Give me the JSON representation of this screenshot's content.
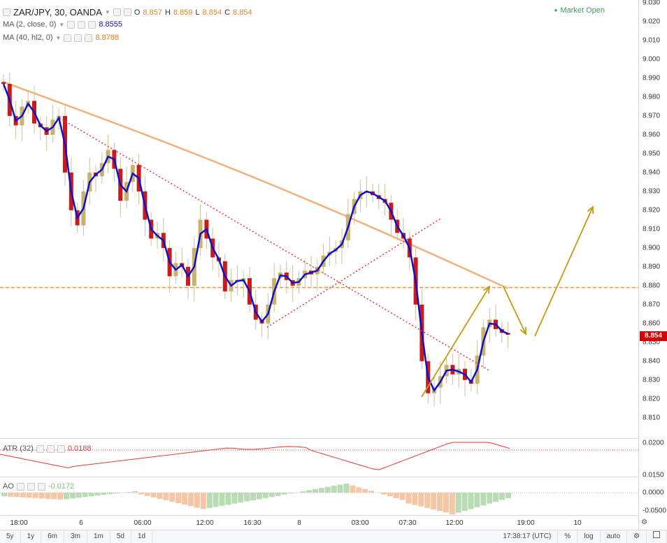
{
  "header": {
    "symbol": "ZAR/JPY, 30, OANDA",
    "open_label": "O",
    "open": "8.857",
    "high_label": "H",
    "high": "8.859",
    "low_label": "L",
    "low": "8.854",
    "close_label": "C",
    "close": "8.854",
    "market_status": "Market Open"
  },
  "indicators": [
    {
      "label": "MA (2, close, 0)",
      "value": "8.8555",
      "color": "#1010c8"
    },
    {
      "label": "MA (40, hl2, 0)",
      "value": "8.8788",
      "color": "#e07b1a"
    }
  ],
  "price_axis": {
    "ticks": [
      "9.030",
      "9.020",
      "9.010",
      "9.000",
      "8.990",
      "8.980",
      "8.970",
      "8.960",
      "8.950",
      "8.940",
      "8.930",
      "8.920",
      "8.910",
      "8.900",
      "8.890",
      "8.880",
      "8.870",
      "8.860",
      "8.850",
      "8.840",
      "8.830",
      "8.820",
      "8.810"
    ],
    "current_price": "8.854",
    "current_price_color": "#d50000"
  },
  "atr": {
    "label": "ATR (32)",
    "value": "0.0188",
    "ticks": [
      "0.0200",
      "0.0150"
    ],
    "color": "#e53935"
  },
  "ao": {
    "label": "AO",
    "value": "-0.0172",
    "ticks": [
      "0.0000",
      "-0.0500"
    ],
    "color": "#7cbf7c"
  },
  "time_axis": [
    "18:00",
    "6",
    "06:00",
    "12:00",
    "16:30",
    "8",
    "03:00",
    "07:30",
    "12:00",
    "19:00",
    "10"
  ],
  "bottom_bar": {
    "ranges": [
      "5y",
      "1y",
      "6m",
      "3m",
      "1m",
      "5d",
      "1d"
    ],
    "clock": "17:38:17 (UTC)",
    "percent": "%",
    "log": "log",
    "auto": "auto"
  },
  "chart_data": {
    "type": "candlestick",
    "title": "ZAR/JPY, 30, OANDA",
    "y_range": [
      8.803,
      9.031
    ],
    "close": [
      8.987,
      8.97,
      8.965,
      8.975,
      8.978,
      8.966,
      8.964,
      8.96,
      8.968,
      8.97,
      8.94,
      8.92,
      8.912,
      8.93,
      8.94,
      8.938,
      8.945,
      8.952,
      8.942,
      8.925,
      8.935,
      8.944,
      8.93,
      8.915,
      8.905,
      8.908,
      8.9,
      8.885,
      8.892,
      8.89,
      8.88,
      8.9,
      8.915,
      8.905,
      8.895,
      8.893,
      8.877,
      8.883,
      8.882,
      8.884,
      8.87,
      8.862,
      8.86,
      8.87,
      8.884,
      8.887,
      8.883,
      8.88,
      8.884,
      8.888,
      8.886,
      8.89,
      8.896,
      8.898,
      8.9,
      8.904,
      8.918,
      8.926,
      8.93,
      8.93,
      8.928,
      8.926,
      8.924,
      8.915,
      8.908,
      8.905,
      8.895,
      8.87,
      8.84,
      8.823,
      8.826,
      8.832,
      8.838,
      8.833,
      8.836,
      8.83,
      8.828,
      8.843,
      8.858,
      8.862,
      8.857,
      8.855,
      8.854
    ],
    "ma2_last": 8.8555,
    "ma40_last": 8.8788,
    "horizontal_level": 8.879,
    "atr_last": 0.0188,
    "ao_last": -0.0172
  }
}
